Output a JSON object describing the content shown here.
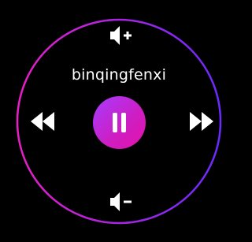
{
  "player": {
    "track_title": "binqingfenxi",
    "state": "playing"
  },
  "controls": {
    "volume_up_icon": "volume-up-icon",
    "volume_down_icon": "volume-down-icon",
    "previous_icon": "rewind-icon",
    "next_icon": "fast-forward-icon",
    "play_pause_icon": "pause-icon"
  },
  "colors": {
    "background": "#000000",
    "ring_start": "#e81ec6",
    "ring_end": "#6a2bff",
    "button_start": "#a63cff",
    "button_end": "#e412a8",
    "icon": "#ffffff"
  }
}
